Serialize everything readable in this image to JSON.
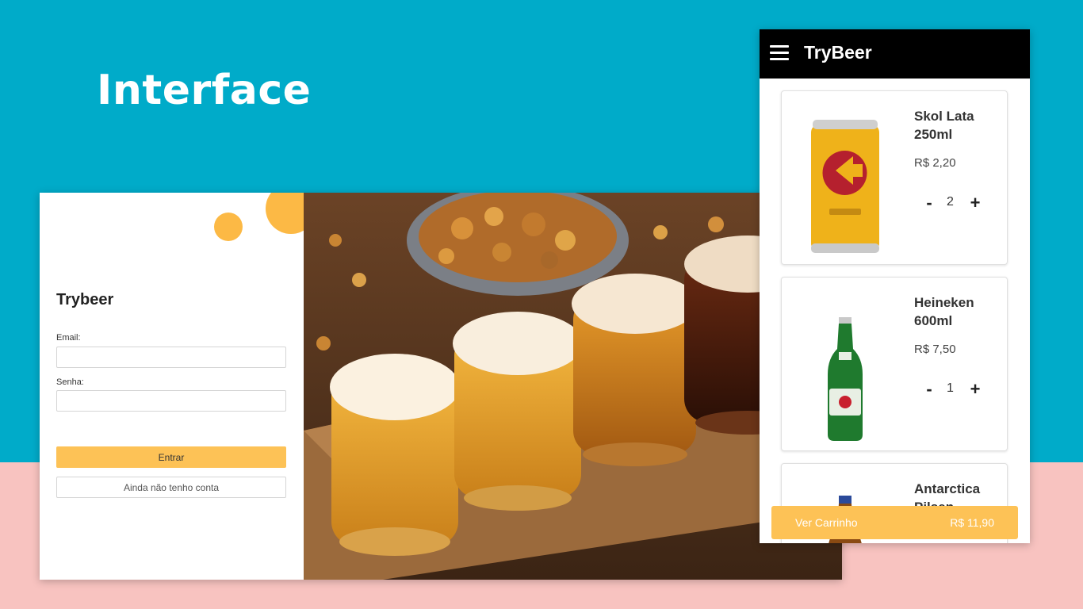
{
  "slide": {
    "title": "Interface"
  },
  "login": {
    "title": "Trybeer",
    "email_label": "Email:",
    "email_value": "",
    "password_label": "Senha:",
    "password_value": "",
    "submit_label": "Entrar",
    "signup_label": "Ainda não tenho conta"
  },
  "mobile": {
    "app_title": "TryBeer",
    "products": [
      {
        "name": "Skol Lata 250ml",
        "price": "R$ 2,20",
        "quantity": "2",
        "image": "beer-can"
      },
      {
        "name": "Heineken 600ml",
        "price": "R$ 7,50",
        "quantity": "1",
        "image": "beer-bottle"
      },
      {
        "name": "Antarctica Pilsen",
        "price": "",
        "quantity": "",
        "image": "beer-bottle"
      }
    ],
    "qty_minus": "-",
    "qty_plus": "+",
    "cart_button_label": "Ver Carrinho",
    "cart_total": "R$ 11,90"
  },
  "colors": {
    "background_top": "#00abc9",
    "background_bottom": "#f8c3c0",
    "accent": "#fdc256",
    "topbar": "#000000"
  }
}
